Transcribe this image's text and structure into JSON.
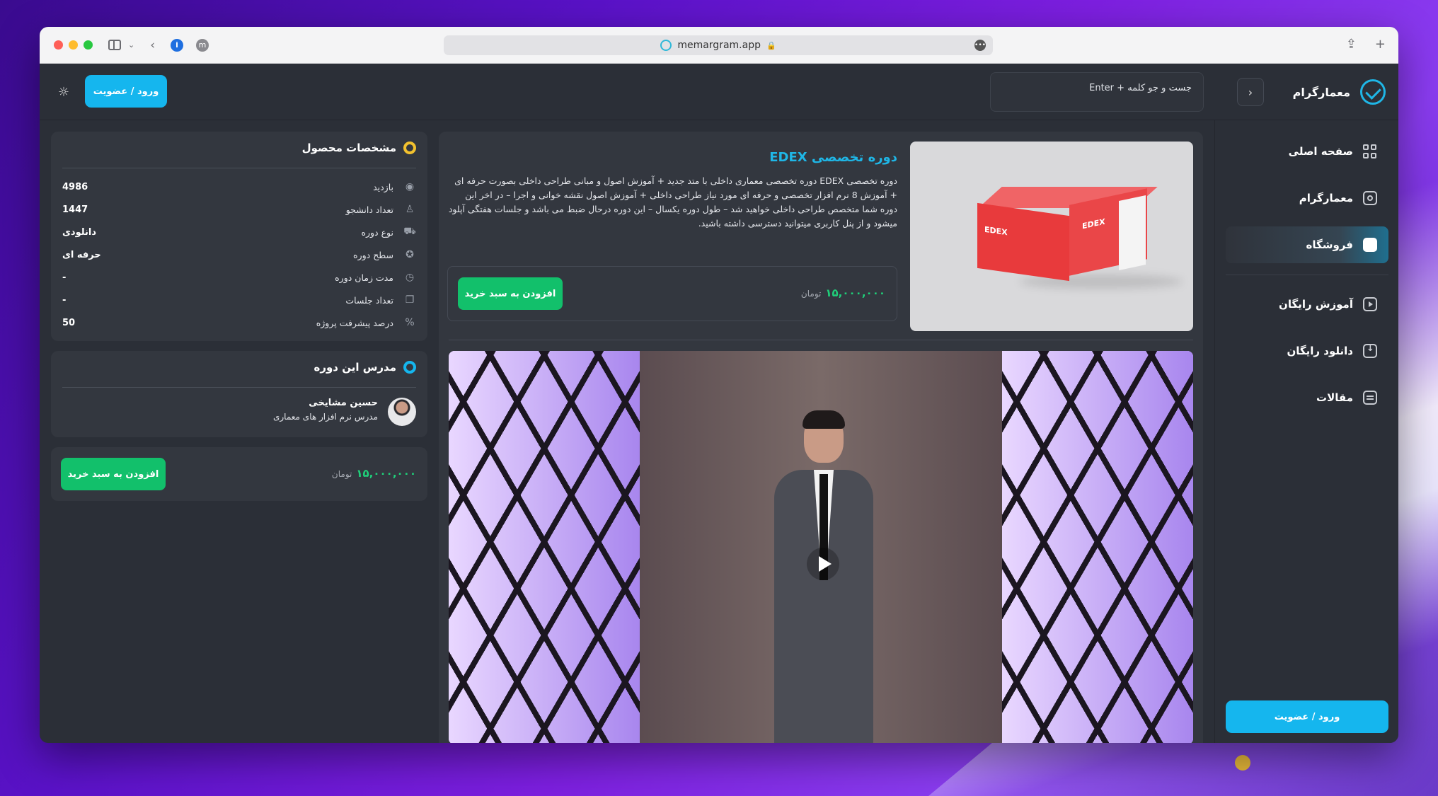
{
  "browser": {
    "url": "memargram.app"
  },
  "header": {
    "brand_name": "معمارگرام",
    "search_placeholder": "جست و جو کلمه + Enter",
    "login_label": "ورود / عضویت"
  },
  "sidebar": {
    "items": [
      {
        "label": "صفحه اصلی",
        "icon": "grid-icon"
      },
      {
        "label": "معمارگرام",
        "icon": "camera-icon"
      },
      {
        "label": "فروشگاه",
        "icon": "shop-icon",
        "active": true
      },
      {
        "label": "آموزش رایگان",
        "icon": "play-icon"
      },
      {
        "label": "دانلود رایگان",
        "icon": "download-icon"
      },
      {
        "label": "مقالات",
        "icon": "article-icon"
      }
    ],
    "login_label": "ورود / عضویت"
  },
  "product": {
    "title": "دوره تخصصی EDEX",
    "description": "دوره تخصصی EDEX دوره تخصصی معماری داخلی با متد جدید + آموزش اصول و مبانی طراحی داخلی بصورت حرفه ای + آموزش 8 نرم افزار تخصصی و حرفه ای مورد نیاز طراحی داخلی + آموزش اصول نقشه خوانی و اجرا – در اخر این دوره شما متخصص طراحی داخلی خواهید شد – طول دوره یکسال – این دوره درحال ضبط می باشد و جلسات هفتگی آپلود میشود و از پنل کاربری میتوانید دسترسی داشته باشید.",
    "price": "۱۵,۰۰۰,۰۰۰",
    "currency": "تومان",
    "add_to_cart": "افزودن به سبد خرید",
    "box_brand": "EDEX"
  },
  "specs": {
    "title": "مشخصات محصول",
    "rows": [
      {
        "label": "بازدید",
        "value": "4986",
        "icon": "eye-icon"
      },
      {
        "label": "تعداد دانشجو",
        "value": "1447",
        "icon": "user-icon"
      },
      {
        "label": "نوع دوره",
        "value": "دانلودی",
        "icon": "truck-icon"
      },
      {
        "label": "سطح دوره",
        "value": "حرفه ای",
        "icon": "level-icon"
      },
      {
        "label": "مدت زمان دوره",
        "value": "-",
        "icon": "clock-icon"
      },
      {
        "label": "تعداد جلسات",
        "value": "-",
        "icon": "sessions-icon"
      },
      {
        "label": "درصد پیشرفت پروژه",
        "value": "50",
        "icon": "percent-icon"
      }
    ]
  },
  "teacher": {
    "title": "مدرس این دوره",
    "name": "حسین مشایخی",
    "role": "مدرس نرم افزار های معماری"
  },
  "buy_card": {
    "price": "۱۵,۰۰۰,۰۰۰",
    "currency": "تومان",
    "add_to_cart": "افزودن به سبد خرید"
  },
  "colors": {
    "accent": "#15b6ee",
    "success": "#12c06b",
    "price": "#1fd07a",
    "panel": "#33373f",
    "background": "#2b2f37"
  }
}
